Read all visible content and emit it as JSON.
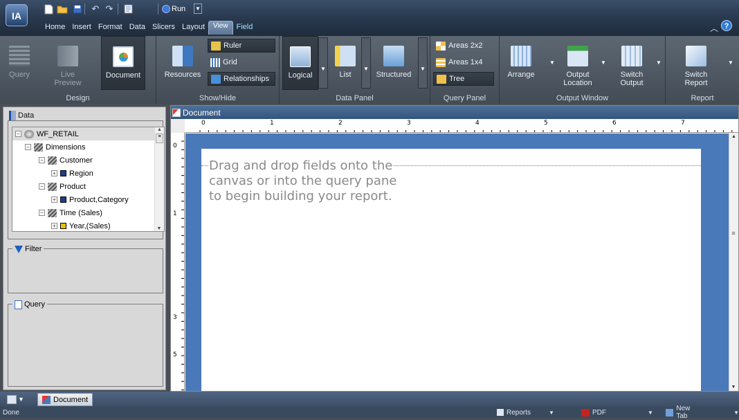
{
  "app": {
    "logo_text": "IA"
  },
  "quick_access": {
    "new_icon": "new-file-icon",
    "open_icon": "open-folder-icon",
    "save_icon": "save-icon",
    "undo_icon": "undo-icon",
    "redo_icon": "redo-icon",
    "report_icon": "report-icon",
    "run_label": "Run"
  },
  "menu_tabs": [
    "Home",
    "Insert",
    "Format",
    "Data",
    "Slicers",
    "Layout",
    "View",
    "Field"
  ],
  "ribbon": {
    "design": {
      "label": "Design",
      "query": "Query",
      "live_preview": [
        "Live",
        "Preview"
      ],
      "document": "Document"
    },
    "showhide": {
      "label": "Show/Hide",
      "resources": "Resources",
      "ruler": "Ruler",
      "grid": "Grid",
      "relationships": "Relationships"
    },
    "datapanel": {
      "label": "Data Panel",
      "logical": "Logical",
      "list": "List",
      "structured": "Structured"
    },
    "querypanel": {
      "label": "Query Panel",
      "areas2x2": "Areas 2x2",
      "areas1x4": "Areas 1x4",
      "tree": "Tree"
    },
    "outputwindow": {
      "label": "Output Window",
      "arrange": "Arrange",
      "output_location": [
        "Output",
        "Location"
      ],
      "switch_output": [
        "Switch",
        "Output"
      ]
    },
    "report": {
      "label": "Report",
      "switch_report": [
        "Switch",
        "Report"
      ]
    }
  },
  "left_panel": {
    "data_title": "Data",
    "tree": [
      {
        "label": "WF_RETAIL",
        "level": 0,
        "expand": "⊟",
        "icon": "datasource-icon"
      },
      {
        "label": "Dimensions",
        "level": 1,
        "expand": "⊟",
        "icon": "dimension-icon"
      },
      {
        "label": "Customer",
        "level": 2,
        "expand": "⊟",
        "icon": "dimension-icon"
      },
      {
        "label": "Region",
        "level": 3,
        "expand": "⊞",
        "icon": "field-icon"
      },
      {
        "label": "Product",
        "level": 2,
        "expand": "⊟",
        "icon": "dimension-icon"
      },
      {
        "label": "Product,Category",
        "level": 3,
        "expand": "⊞",
        "icon": "field-icon"
      },
      {
        "label": "Time (Sales)",
        "level": 2,
        "expand": "⊟",
        "icon": "dimension-icon"
      },
      {
        "label": "Year,(Sales)",
        "level": 3,
        "expand": "⊞",
        "icon": "field-icon-yellow"
      }
    ],
    "filter_title": "Filter",
    "query_title": "Query"
  },
  "canvas": {
    "tab_label": "Document",
    "ruler_h": [
      "0",
      "1",
      "2",
      "3",
      "4",
      "5",
      "6",
      "7"
    ],
    "ruler_v": [
      "0",
      "1",
      "3",
      "5"
    ],
    "hint_lines": [
      "Drag and drop fields onto the",
      "canvas or into the query pane",
      "to begin building your report."
    ]
  },
  "bottom": {
    "doc_tab": "Document"
  },
  "status": {
    "left": "Done",
    "reports": "Reports",
    "pdf": "PDF",
    "newtab": "New Tab"
  },
  "colors": {
    "accent": "#4a79b9",
    "ribbon": "#4b545e",
    "titlebar": "#29394e"
  }
}
